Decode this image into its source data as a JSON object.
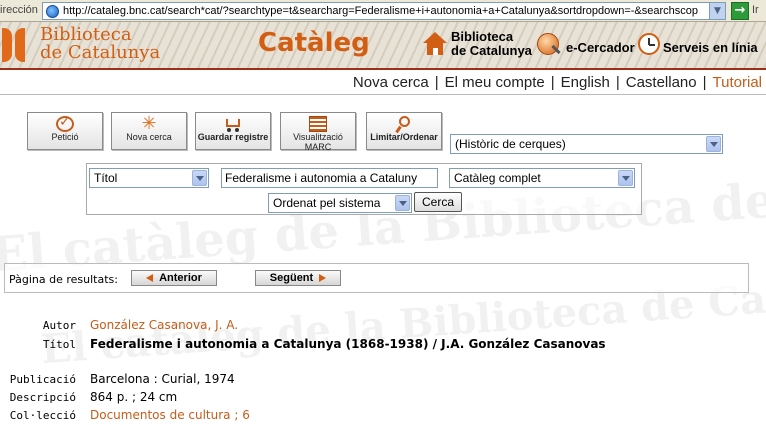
{
  "browser": {
    "address_label": "irección",
    "url": "http://cataleg.bnc.cat/search*cat/?searchtype=t&searcharg=Federalisme+i+autonomia+a+Catalunya&sortdropdown=-&searchscop",
    "go_label": "Ir"
  },
  "header": {
    "logo_line1": "Biblioteca",
    "logo_line2": "de Catalunya",
    "title": "Catàleg",
    "bib_link_line1": "Biblioteca",
    "bib_link_line2": "de Catalunya",
    "ecercador": "e-Cercador",
    "serveis": "Serveis en línia"
  },
  "nav": {
    "items": [
      {
        "label": "Nova cerca"
      },
      {
        "label": "El meu compte"
      },
      {
        "label": "English"
      },
      {
        "label": "Castellano"
      },
      {
        "label": "Tutorial"
      }
    ],
    "separator": "|"
  },
  "watermark": {
    "text1": "El catàleg de la Biblioteca de Catalunya",
    "text2": "El catàleg de la Biblioteca de Catalunya"
  },
  "toolbar": {
    "peticio": "Petició",
    "nova_cerca": "Nova cerca",
    "guardar": "Guardar registre",
    "marc_line1": "Visualització",
    "marc_line2": "MARC",
    "limitar": "Limitar/Ordenar",
    "historic": "(Històric de cerques)"
  },
  "search": {
    "field_type": "Títol",
    "query": "Federalisme i autonomia a Cataluny",
    "scope": "Catàleg complet",
    "sort": "Ordenat pel sistema",
    "submit": "Cerca"
  },
  "results_nav": {
    "label": "Pàgina de resultats:",
    "prev": "Anterior",
    "next": "Següent"
  },
  "record": {
    "author_label": "Autor",
    "author": "González Casanova, J. A.",
    "title_label": "Títol",
    "title": "Federalisme i autonomia a Catalunya (1868-1938) / J.A. González Casanovas",
    "pub_label": "Publicació",
    "publication": "Barcelona : Curial, 1974",
    "desc_label": "Descripció",
    "description": "864 p. ; 24 cm",
    "coll_label": "Col·lecció",
    "collection": "Documentos de cultura ; 6"
  },
  "colors": {
    "brand_orange": "#d15e12",
    "link_orange": "#c65c1a",
    "rule_red": "#9a2f1a"
  }
}
